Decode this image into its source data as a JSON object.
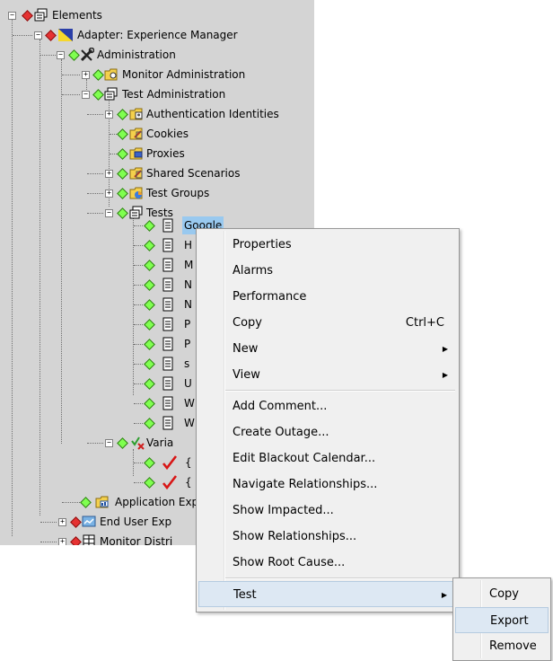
{
  "tree": {
    "rows": [
      {
        "label": "Elements"
      },
      {
        "label": "Adapter: Experience Manager"
      },
      {
        "label": "Administration"
      },
      {
        "label": "Monitor Administration"
      },
      {
        "label": "Test Administration"
      },
      {
        "label": "Authentication Identities"
      },
      {
        "label": "Cookies"
      },
      {
        "label": "Proxies"
      },
      {
        "label": "Shared Scenarios"
      },
      {
        "label": "Test Groups"
      },
      {
        "label": "Tests"
      },
      {
        "label": "Google"
      },
      {
        "label": "H"
      },
      {
        "label": "M"
      },
      {
        "label": "N"
      },
      {
        "label": "N"
      },
      {
        "label": "P"
      },
      {
        "label": "P"
      },
      {
        "label": "s"
      },
      {
        "label": "U"
      },
      {
        "label": "W"
      },
      {
        "label": "W"
      },
      {
        "label": "Varia"
      },
      {
        "label": "{"
      },
      {
        "label": "{"
      },
      {
        "label": "Application Exp"
      },
      {
        "label": "End User Exp"
      },
      {
        "label": "Monitor Distri"
      }
    ]
  },
  "context_menu": {
    "items": [
      {
        "label": "Properties",
        "shortcut": ""
      },
      {
        "label": "Alarms",
        "shortcut": ""
      },
      {
        "label": "Performance",
        "shortcut": ""
      },
      {
        "label": "Copy",
        "shortcut": "Ctrl+C"
      },
      {
        "label": "New",
        "shortcut": ""
      },
      {
        "label": "View",
        "shortcut": ""
      },
      {
        "label": "Add Comment...",
        "shortcut": ""
      },
      {
        "label": "Create Outage...",
        "shortcut": ""
      },
      {
        "label": "Edit Blackout Calendar...",
        "shortcut": ""
      },
      {
        "label": "Navigate Relationships...",
        "shortcut": ""
      },
      {
        "label": "Show Impacted...",
        "shortcut": ""
      },
      {
        "label": "Show Relationships...",
        "shortcut": ""
      },
      {
        "label": "Show Root Cause...",
        "shortcut": ""
      },
      {
        "label": "Test",
        "shortcut": ""
      }
    ]
  },
  "submenu": {
    "items": [
      {
        "label": "Copy"
      },
      {
        "label": "Export"
      },
      {
        "label": "Remove"
      }
    ]
  },
  "colors": {
    "tree_bg": "#d4d4d4",
    "selection": "#99c9ef",
    "menu_bg": "#f0f0f0",
    "menu_highlight": "#dde8f3",
    "status_green": "#7fff4f",
    "status_red": "#e53232"
  }
}
